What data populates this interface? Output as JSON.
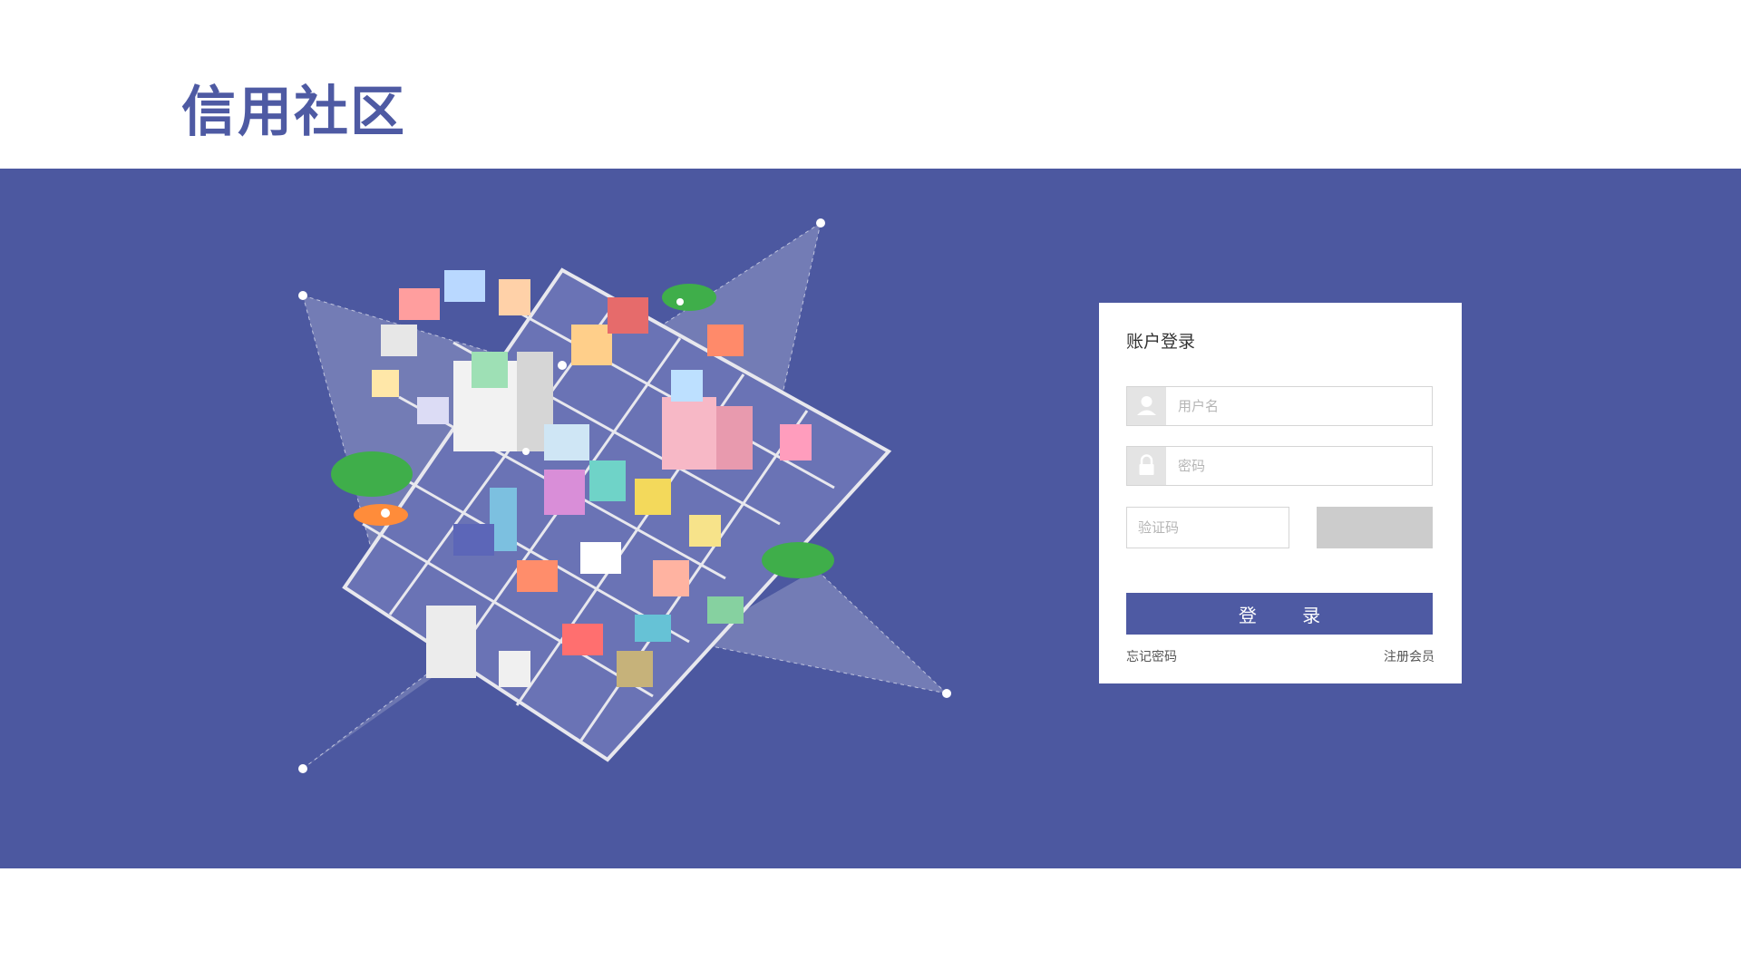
{
  "header": {
    "logo_text": "信用社区"
  },
  "login": {
    "title": "账户登录",
    "username_placeholder": "用户名",
    "password_placeholder": "密码",
    "captcha_placeholder": "验证码",
    "submit_label": "登 录",
    "forgot_password": "忘记密码",
    "register": "注册会员"
  },
  "colors": {
    "brand": "#4e5aa3",
    "band": "#4c58a0",
    "icon_box": "#e4e4e4",
    "captcha_bg": "#cccccc"
  },
  "icons": {
    "username": "user-icon",
    "password": "lock-icon"
  }
}
